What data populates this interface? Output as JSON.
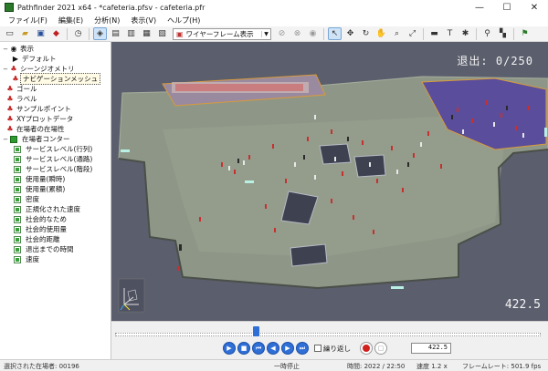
{
  "window": {
    "title": "Pathfinder 2021 x64 - *cafeteria.pfsv - cafeteria.pfr",
    "minimize": "—",
    "maximize": "☐",
    "close": "✕"
  },
  "menu": [
    "ファイル(F)",
    "編集(E)",
    "分析(N)",
    "表示(V)",
    "ヘルプ(H)"
  ],
  "toolbar": {
    "view_mode": "ワイヤーフレーム表示",
    "icons": [
      "new-icon",
      "open-icon",
      "save-icon",
      "import-icon",
      "history-icon",
      "view-perspective-icon",
      "view-top-icon",
      "view-front-icon",
      "view-side-icon",
      "camera-icon",
      "lock-icon",
      "unlock-icon",
      "pointer-icon",
      "move-icon",
      "rotate-icon",
      "pan-icon",
      "zoom-icon",
      "zoom-fit-icon",
      "measure-icon",
      "text-icon",
      "settings-icon",
      "agent-add-icon",
      "agent-count-icon",
      "exit-icon"
    ]
  },
  "tree": [
    {
      "label": "表示",
      "level": 0,
      "icon": "eye-icon",
      "toggle": "−"
    },
    {
      "label": "デフォルト",
      "level": 1,
      "icon": "camera-icon",
      "toggle": ""
    },
    {
      "label": "シーンジオメトリ",
      "level": 0,
      "icon": "geometry-icon",
      "toggle": "−"
    },
    {
      "label": "ナビゲーションメッシュ",
      "level": 1,
      "icon": "navmesh-icon",
      "toggle": "",
      "selected": true
    },
    {
      "label": "ゴール",
      "level": 0,
      "icon": "goal-icon",
      "toggle": ""
    },
    {
      "label": "ラベル",
      "level": 0,
      "icon": "label-icon",
      "toggle": ""
    },
    {
      "label": "サンプルポイント",
      "level": 0,
      "icon": "sample-point-icon",
      "toggle": ""
    },
    {
      "label": "XYプロットデータ",
      "level": 0,
      "icon": "xy-plot-icon",
      "toggle": ""
    },
    {
      "label": "在場者の在場性",
      "level": 0,
      "icon": "occupant-icon",
      "toggle": ""
    },
    {
      "label": "在場者コンター",
      "level": 0,
      "icon": "contour-icon",
      "toggle": "−"
    },
    {
      "label": "サービスレベル(行列)",
      "level": 1,
      "icon": "checkbox-icon",
      "toggle": ""
    },
    {
      "label": "サービスレベル(通路)",
      "level": 1,
      "icon": "checkbox-icon",
      "toggle": ""
    },
    {
      "label": "サービスレベル(階段)",
      "level": 1,
      "icon": "checkbox-icon",
      "toggle": ""
    },
    {
      "label": "使用量(瞬時)",
      "level": 1,
      "icon": "checkbox-icon",
      "toggle": ""
    },
    {
      "label": "使用量(累積)",
      "level": 1,
      "icon": "checkbox-icon",
      "toggle": ""
    },
    {
      "label": "密度",
      "level": 1,
      "icon": "checkbox-icon",
      "toggle": ""
    },
    {
      "label": "正規化された速度",
      "level": 1,
      "icon": "checkbox-icon",
      "toggle": ""
    },
    {
      "label": "社会的なため",
      "level": 1,
      "icon": "checkbox-icon",
      "toggle": ""
    },
    {
      "label": "社会的使用量",
      "level": 1,
      "icon": "checkbox-icon",
      "toggle": ""
    },
    {
      "label": "社会的距離",
      "level": 1,
      "icon": "checkbox-icon",
      "toggle": ""
    },
    {
      "label": "退出までの時間",
      "level": 1,
      "icon": "checkbox-icon",
      "toggle": ""
    },
    {
      "label": "速度",
      "level": 1,
      "icon": "checkbox-icon",
      "toggle": ""
    }
  ],
  "viewport": {
    "exit_label": "退出:",
    "exit_count": "0/250",
    "time": "422.5",
    "exit_progress": 0
  },
  "playback": {
    "position_fraction": 0.33,
    "buttons": [
      "play-icon",
      "stop-icon",
      "skip-start-icon",
      "step-back-icon",
      "step-forward-icon",
      "skip-end-icon"
    ],
    "loop_label": "繰り返し",
    "time_value": "422.5"
  },
  "status": {
    "selected": "選択された在場者: 00196",
    "state": "一時停止",
    "time": "時間: 2022 / 22:50",
    "speed": "速度 1.2 x",
    "framerate": "フレームレート: 501.9 fps"
  },
  "colors": {
    "floor": "#8e9787",
    "exit_zone": "#5a4d9c",
    "queue_zone": "#9a8aa0",
    "background": "#5b5e6c",
    "accent": "#2f6fd6"
  }
}
